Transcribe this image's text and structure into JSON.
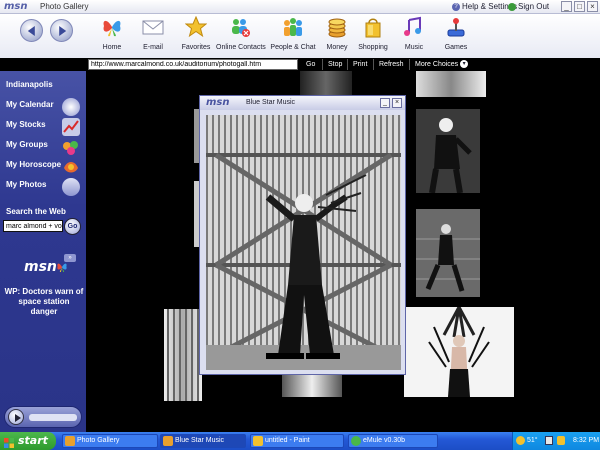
{
  "window": {
    "brand": "msn",
    "title": "Photo Gallery",
    "help": "Help & Settings",
    "signout": "Sign Out",
    "controls": {
      "minimize": "_",
      "maximize": "□",
      "close": "×"
    }
  },
  "toolbar": {
    "items": [
      {
        "label": "Home",
        "icon": "butterfly-icon"
      },
      {
        "label": "E-mail",
        "icon": "envelope-icon"
      },
      {
        "label": "Favorites",
        "icon": "star-icon"
      },
      {
        "label": "Online Contacts",
        "icon": "contacts-icon"
      },
      {
        "label": "People & Chat",
        "icon": "people-icon"
      },
      {
        "label": "Money",
        "icon": "coins-icon"
      },
      {
        "label": "Shopping",
        "icon": "bag-icon"
      },
      {
        "label": "Music",
        "icon": "music-icon"
      },
      {
        "label": "Games",
        "icon": "joystick-icon"
      }
    ]
  },
  "address": {
    "url": "http://www.marcalmond.co.uk/auditorium/photogall.htm",
    "go": "Go",
    "stop": "Stop",
    "print": "Print",
    "refresh": "Refresh",
    "more": "More Choices"
  },
  "sidebar": {
    "city": "Indianapolis",
    "items": [
      {
        "label": "My Calendar"
      },
      {
        "label": "My Stocks"
      },
      {
        "label": "My Groups"
      },
      {
        "label": "My Horoscope"
      },
      {
        "label": "My Photos"
      }
    ],
    "search_label": "Search the Web",
    "search_value": "marc almond + voy",
    "go_label": "Go",
    "logo": "msn",
    "news": "WP: Doctors warn of space station danger"
  },
  "popup": {
    "brand": "msn",
    "title": "Blue Star Music",
    "minimize": "_",
    "close": "×"
  },
  "taskbar": {
    "start": "start",
    "tasks": [
      {
        "label": "Photo Gallery"
      },
      {
        "label": "Blue Star Music"
      },
      {
        "label": "untitled - Paint"
      },
      {
        "label": "eMule v0.30b"
      }
    ],
    "temp": "51°",
    "clock": "8:32 PM"
  },
  "colors": {
    "sidebar": "#2e3890",
    "taskbar": "#2458d6",
    "start": "#3aa83a",
    "page_bg": "#000000"
  }
}
